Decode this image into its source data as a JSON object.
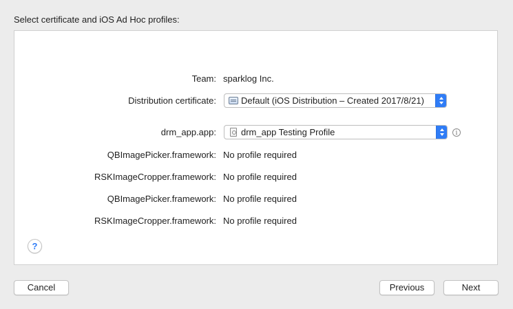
{
  "header": {
    "title": "Select certificate and iOS Ad Hoc profiles:"
  },
  "team": {
    "label": "Team:",
    "value": "sparklog Inc."
  },
  "distribution_certificate": {
    "label": "Distribution certificate:",
    "selected": "Default (iOS Distribution – Created 2017/8/21)",
    "icon": "certificate-icon"
  },
  "app": {
    "label": "drm_app.app:",
    "selected": "drm_app Testing Profile",
    "icon": "provisioning-profile-icon",
    "info_icon": "info-icon",
    "info_glyph": "i"
  },
  "frameworks": [
    {
      "label": "QBImagePicker.framework:",
      "value": "No profile required"
    },
    {
      "label": "RSKImageCropper.framework:",
      "value": "No profile required"
    },
    {
      "label": "QBImagePicker.framework:",
      "value": "No profile required"
    },
    {
      "label": "RSKImageCropper.framework:",
      "value": "No profile required"
    }
  ],
  "help_button": {
    "glyph": "?"
  },
  "buttons": {
    "cancel": "Cancel",
    "previous": "Previous",
    "next": "Next"
  },
  "colors": {
    "accent": "#2f7cf6",
    "window_background": "#ececec",
    "panel_background": "#ffffff"
  }
}
